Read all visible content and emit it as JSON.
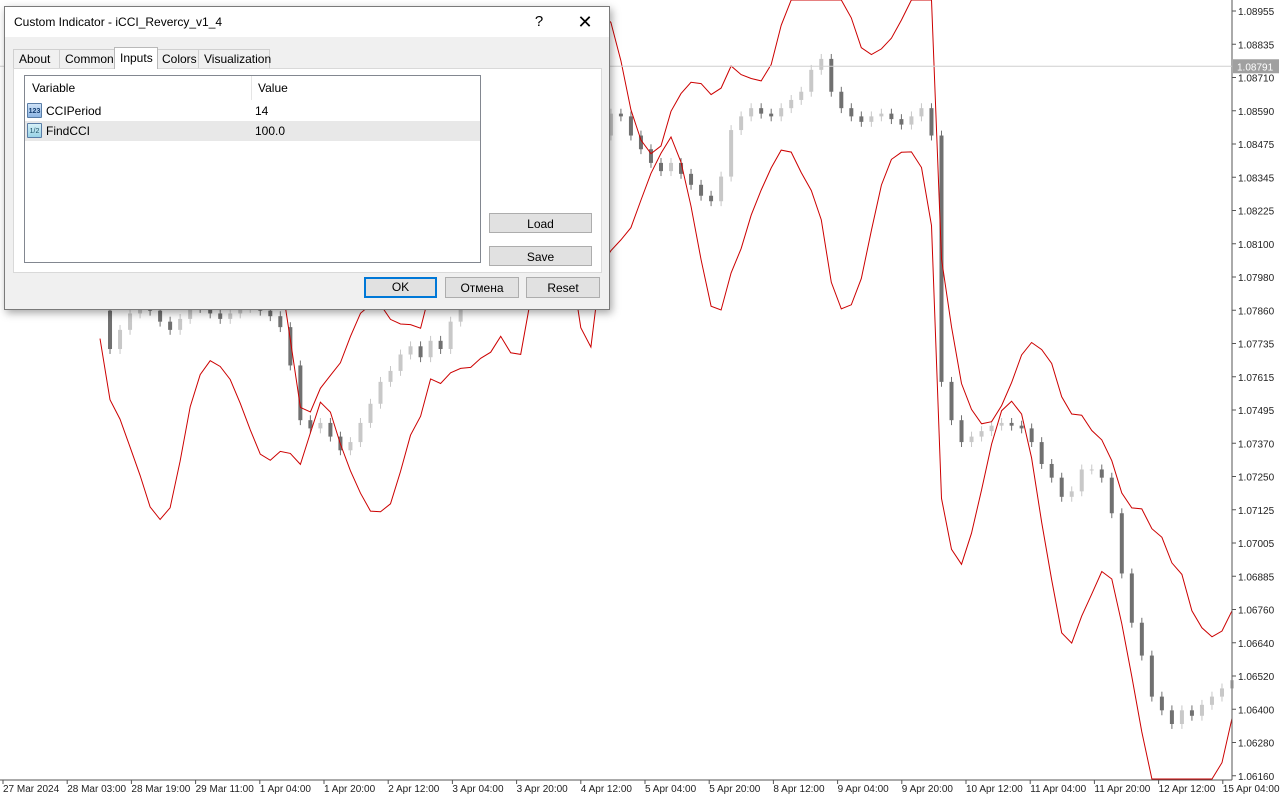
{
  "dialog": {
    "title": "Custom Indicator - iCCI_Revercy_v1_4",
    "help_label": "?",
    "close_label": "✕",
    "tabs": [
      {
        "label": "About"
      },
      {
        "label": "Common"
      },
      {
        "label": "Inputs",
        "active": true
      },
      {
        "label": "Colors"
      },
      {
        "label": "Visualization"
      }
    ],
    "table": {
      "headers": {
        "variable": "Variable",
        "value": "Value"
      },
      "rows": [
        {
          "icon": "integer-type-icon",
          "icon_text": "123",
          "name": "CCIPeriod",
          "value": "14"
        },
        {
          "icon": "double-type-icon",
          "icon_text": "1/2",
          "name": "FindCCI",
          "value": "100.0"
        }
      ]
    },
    "buttons": {
      "load": "Load",
      "save": "Save",
      "ok": "OK",
      "cancel": "Отмена",
      "reset": "Reset"
    }
  },
  "colors": {
    "envelope": "#cc0000",
    "bull_candle": "#c8c8c8",
    "bear_candle": "#707070",
    "grid_bg": "#ffffff",
    "price_tag": "#a0a0a0"
  },
  "chart": {
    "current_price": "1.08791",
    "price_labels": [
      "1.08955",
      "1.08835",
      "1.08710",
      "1.08590",
      "1.08475",
      "1.08345",
      "1.08225",
      "1.08100",
      "1.07980",
      "1.07860",
      "1.07735",
      "1.07615",
      "1.07495",
      "1.07370",
      "1.07250",
      "1.07125",
      "1.07005",
      "1.06885",
      "1.06760",
      "1.06640",
      "1.06520",
      "1.06400",
      "1.06280",
      "1.06160"
    ],
    "time_labels": [
      "27 Mar 2024",
      "28 Mar 03:00",
      "28 Mar 19:00",
      "29 Mar 11:00",
      "1 Apr 04:00",
      "1 Apr 20:00",
      "2 Apr 12:00",
      "3 Apr 04:00",
      "3 Apr 20:00",
      "4 Apr 12:00",
      "5 Apr 04:00",
      "5 Apr 20:00",
      "8 Apr 12:00",
      "9 Apr 04:00",
      "9 Apr 20:00",
      "10 Apr 12:00",
      "11 Apr 04:00",
      "11 Apr 20:00",
      "12 Apr 12:00",
      "15 Apr 04:00"
    ],
    "price_series": [
      1.0786,
      1.0772,
      1.0779,
      1.0785,
      1.0789,
      1.0786,
      1.0782,
      1.0779,
      1.0783,
      1.0788,
      1.0787,
      1.0785,
      1.0783,
      1.0785,
      1.0787,
      1.0788,
      1.0786,
      1.0784,
      1.078,
      1.0766,
      1.0746,
      1.0743,
      1.0745,
      1.074,
      1.0735,
      1.0738,
      1.0745,
      1.0752,
      1.076,
      1.0764,
      1.077,
      1.0773,
      1.0769,
      1.0775,
      1.0772,
      1.0782,
      1.0796,
      1.0812,
      1.083,
      1.0842,
      1.085,
      1.0838,
      1.0825,
      1.083,
      1.0838,
      1.084,
      1.0832,
      1.0822,
      1.0808,
      1.0812,
      1.085,
      1.0858,
      1.0857,
      1.085,
      1.0845,
      1.084,
      1.0837,
      1.084,
      1.0836,
      1.0832,
      1.0828,
      1.0826,
      1.0835,
      1.0852,
      1.0857,
      1.086,
      1.0858,
      1.0857,
      1.086,
      1.0863,
      1.0866,
      1.0874,
      1.0878,
      1.0866,
      1.086,
      1.0857,
      1.0855,
      1.0857,
      1.0858,
      1.0856,
      1.0854,
      1.0857,
      1.086,
      1.085,
      1.076,
      1.0746,
      1.0738,
      1.074,
      1.0742,
      1.0744,
      1.0745,
      1.0744,
      1.0743,
      1.0738,
      1.073,
      1.0725,
      1.0718,
      1.072,
      1.0728,
      1.0728,
      1.0725,
      1.0712,
      1.069,
      1.0672,
      1.066,
      1.0645,
      1.064,
      1.0635,
      1.064,
      1.0638,
      1.0642,
      1.0645,
      1.0648,
      1.0651
    ]
  }
}
